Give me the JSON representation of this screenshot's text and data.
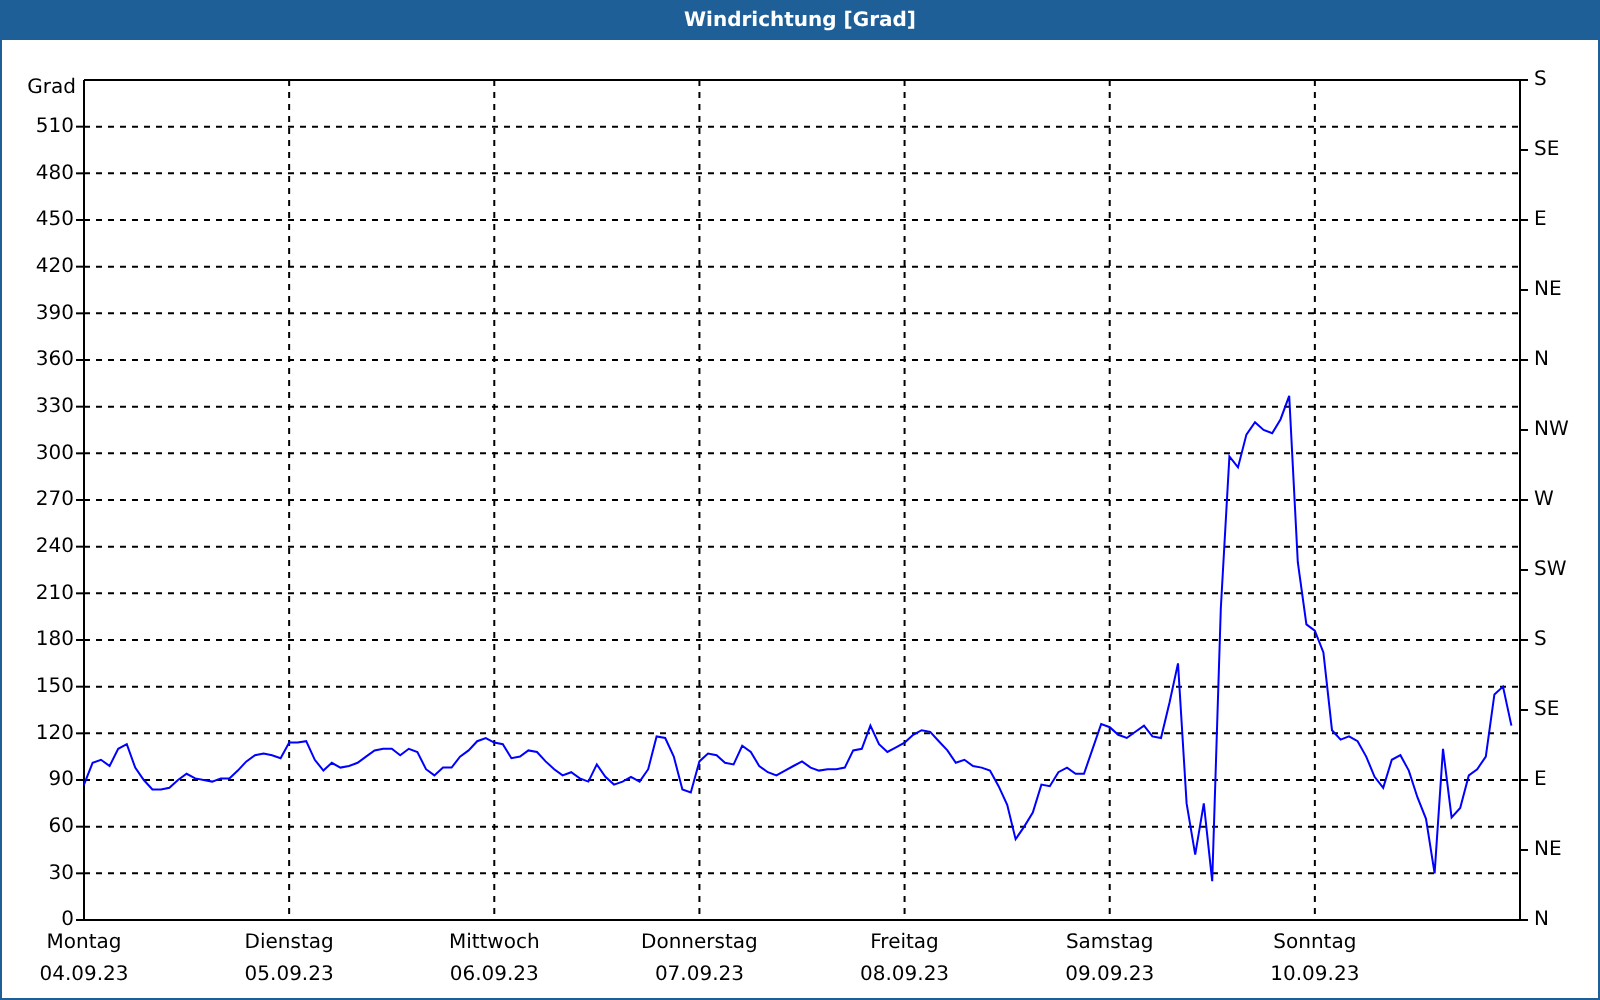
{
  "window": {
    "title": "Windrichtung [Grad]"
  },
  "chart": {
    "chart_data": {
      "type": "line",
      "ylabel": "Grad",
      "ylim": [
        0,
        540
      ],
      "grid": true,
      "categories": [
        "Montag\n04.09.23",
        null,
        null,
        null,
        null,
        null,
        null,
        null,
        null,
        null,
        null,
        null,
        null,
        null,
        null,
        null,
        null,
        null,
        null,
        null,
        null,
        null,
        null,
        null,
        "Dienstag\n05.09.23",
        null,
        null,
        null,
        null,
        null,
        null,
        null,
        null,
        null,
        null,
        null,
        null,
        null,
        null,
        null,
        null,
        null,
        null,
        null,
        null,
        null,
        null,
        null,
        "Mittwoch\n06.09.23",
        null,
        null,
        null,
        null,
        null,
        null,
        null,
        null,
        null,
        null,
        null,
        null,
        null,
        null,
        null,
        null,
        null,
        null,
        null,
        null,
        null,
        null,
        null,
        "Donnerstag\n07.09.23",
        null,
        null,
        null,
        null,
        null,
        null,
        null,
        null,
        null,
        null,
        null,
        null,
        null,
        null,
        null,
        null,
        null,
        null,
        null,
        null,
        null,
        null,
        null,
        "Freitag\n08.09.23",
        null,
        null,
        null,
        null,
        null,
        null,
        null,
        null,
        null,
        null,
        null,
        null,
        null,
        null,
        null,
        null,
        null,
        null,
        null,
        null,
        null,
        null,
        null,
        "Samstag\n09.09.23",
        null,
        null,
        null,
        null,
        null,
        null,
        null,
        null,
        null,
        null,
        null,
        null,
        null,
        null,
        null,
        null,
        null,
        null,
        null,
        null,
        null,
        null,
        null,
        "Sonntag\n10.09.23",
        null,
        null,
        null,
        null,
        null,
        null,
        null,
        null,
        null,
        null,
        null,
        null,
        null,
        null,
        null,
        null,
        null,
        null,
        null,
        null,
        null,
        null,
        null
      ],
      "series": [
        {
          "color": "#0000ff",
          "values": [
            87,
            101,
            103,
            99,
            110,
            113,
            98,
            90,
            84,
            84,
            85,
            90,
            94,
            91,
            90,
            89,
            91,
            91,
            96,
            102,
            106,
            107,
            106,
            104,
            114,
            114,
            115,
            103,
            96,
            101,
            98,
            99,
            101,
            105,
            109,
            110,
            110,
            106,
            110,
            108,
            97,
            93,
            98,
            98,
            105,
            109,
            115,
            117,
            114,
            113,
            104,
            105,
            109,
            108,
            102,
            97,
            93,
            95,
            91,
            89,
            100,
            92,
            87,
            89,
            92,
            89,
            97,
            118,
            117,
            105,
            84,
            82,
            102,
            107,
            106,
            101,
            100,
            112,
            108,
            99,
            95,
            93,
            96,
            99,
            102,
            98,
            96,
            97,
            97,
            98,
            109,
            110,
            125,
            113,
            108,
            111,
            114,
            119,
            122,
            121,
            115,
            109,
            101,
            103,
            99,
            98,
            96,
            86,
            74,
            52,
            60,
            69,
            87,
            86,
            95,
            98,
            94,
            94,
            110,
            126,
            124,
            119,
            117,
            121,
            125,
            118,
            117,
            140,
            165,
            75,
            42,
            75,
            25,
            200,
            298,
            291,
            312,
            320,
            315,
            313,
            322,
            337,
            230,
            190,
            186,
            172,
            122,
            116,
            118,
            115,
            105,
            92,
            85,
            103,
            106,
            96,
            79,
            65,
            30,
            110,
            66,
            72,
            93,
            97,
            105,
            145,
            150,
            125
          ]
        }
      ],
      "yticks": [
        0,
        30,
        60,
        90,
        120,
        150,
        180,
        210,
        240,
        270,
        300,
        330,
        360,
        390,
        420,
        450,
        480,
        510
      ]
    },
    "directions": [
      "S",
      "SE",
      "E",
      "NE",
      "N",
      "NW",
      "W",
      "SW",
      "S",
      "SE",
      "E",
      "NE",
      "N"
    ]
  }
}
